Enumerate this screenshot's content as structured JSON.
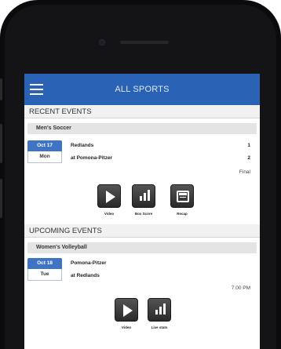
{
  "header": {
    "title": "ALL SPORTS",
    "menu_icon": "hamburger-menu-icon",
    "color": "#2a63b6"
  },
  "recent": {
    "heading": "RECENT EVENTS",
    "sport": "Men's Soccer",
    "date": {
      "month_day": "Oct 17",
      "weekday": "Mon"
    },
    "home_team": "Redlands",
    "away_team": "at Pomona-Pitzer",
    "home_score": "1",
    "away_score": "2",
    "status": "Final",
    "actions": [
      {
        "label": "Video",
        "icon": "play-icon"
      },
      {
        "label": "Box Score",
        "icon": "bar-chart-icon"
      },
      {
        "label": "Recap",
        "icon": "recap-icon"
      }
    ]
  },
  "upcoming": {
    "heading": "UPCOMING EVENTS",
    "sport": "Women's Volleyball",
    "date": {
      "month_day": "Oct 18",
      "weekday": "Tue"
    },
    "home_team": "Pomona-Pitzer",
    "away_team": "at Redlands",
    "time": "7:00 PM",
    "actions": [
      {
        "label": "Video",
        "icon": "play-icon"
      },
      {
        "label": "Live stats",
        "icon": "bar-chart-icon"
      }
    ]
  },
  "colors": {
    "accent": "#3f73c3",
    "tile": "#3a3a3a"
  }
}
